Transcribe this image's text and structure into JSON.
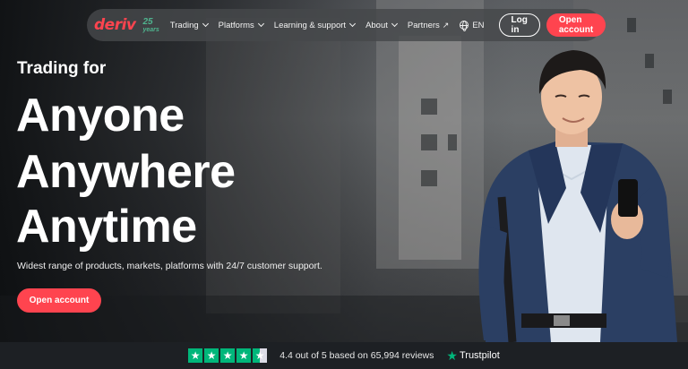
{
  "nav": {
    "logo_text": "deriv",
    "years_number": "25",
    "years_label": "years",
    "items": [
      {
        "label": "Trading",
        "has_chevron": true
      },
      {
        "label": "Platforms",
        "has_chevron": true
      },
      {
        "label": "Learning & support",
        "has_chevron": true
      },
      {
        "label": "About",
        "has_chevron": true
      },
      {
        "label": "Partners",
        "icon": "external-arrow-icon"
      }
    ],
    "language": "EN",
    "login_label": "Log in",
    "open_account_label": "Open account"
  },
  "hero": {
    "subtitle": "Trading for",
    "lines": [
      "Anyone",
      "Anywhere",
      "Anytime"
    ],
    "description": "Widest range of products, markets, platforms with 24/7 customer support.",
    "cta_label": "Open account"
  },
  "trustpilot": {
    "rating_text": "4.4 out of 5 based on 65,994 reviews",
    "brand": "Trustpilot",
    "stars": 4.5
  },
  "colors": {
    "accent": "#ff444f",
    "trustpilot_green": "#00b67a",
    "years_green": "#4fb38e"
  }
}
